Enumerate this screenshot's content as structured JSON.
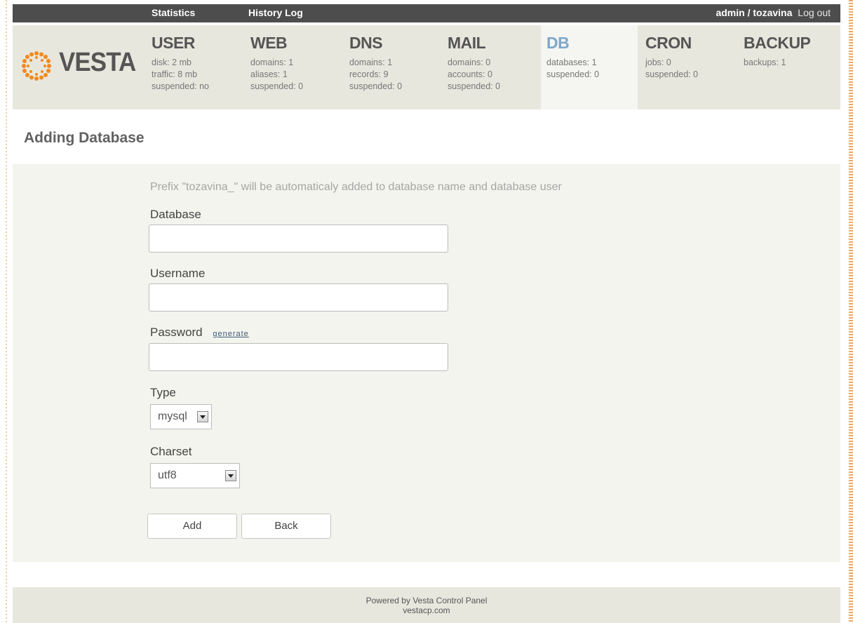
{
  "topbar": {
    "links": [
      "Statistics",
      "History Log"
    ],
    "user": "admin / tozavina",
    "logout": "Log out"
  },
  "logo": {
    "text": "VESTA",
    "icon": "sun-dots-logo-icon",
    "color": "#f28a1c"
  },
  "tabs": [
    {
      "title": "USER",
      "stats": [
        "disk: 2 mb",
        "traffic: 8 mb",
        "suspended: no"
      ]
    },
    {
      "title": "WEB",
      "stats": [
        "domains: 1",
        "aliases: 1",
        "suspended: 0"
      ]
    },
    {
      "title": "DNS",
      "stats": [
        "domains: 1",
        "records: 9",
        "suspended: 0"
      ]
    },
    {
      "title": "MAIL",
      "stats": [
        "domains: 0",
        "accounts: 0",
        "suspended: 0"
      ]
    },
    {
      "title": "DB",
      "stats": [
        "databases: 1",
        "suspended: 0"
      ],
      "active": true
    },
    {
      "title": "CRON",
      "stats": [
        "jobs: 0",
        "suspended: 0"
      ]
    },
    {
      "title": "BACKUP",
      "stats": [
        "backups: 1"
      ]
    }
  ],
  "page": {
    "title": "Adding Database"
  },
  "form": {
    "hint": "Prefix \"tozavina_\" will be automaticaly added to database name and database user",
    "database_label": "Database",
    "database_value": "",
    "username_label": "Username",
    "username_value": "",
    "password_label": "Password",
    "generate_label": "generate",
    "password_value": "",
    "type_label": "Type",
    "type_value": "mysql",
    "charset_label": "Charset",
    "charset_value": "utf8",
    "add_label": "Add",
    "back_label": "Back"
  },
  "footer": {
    "line1": "Powered by Vesta Control Panel",
    "line2": "vestacp.com"
  },
  "colors": {
    "active_tab": "#7ea8cc",
    "topbar": "#4d4d4d",
    "header": "#e8e7de"
  }
}
